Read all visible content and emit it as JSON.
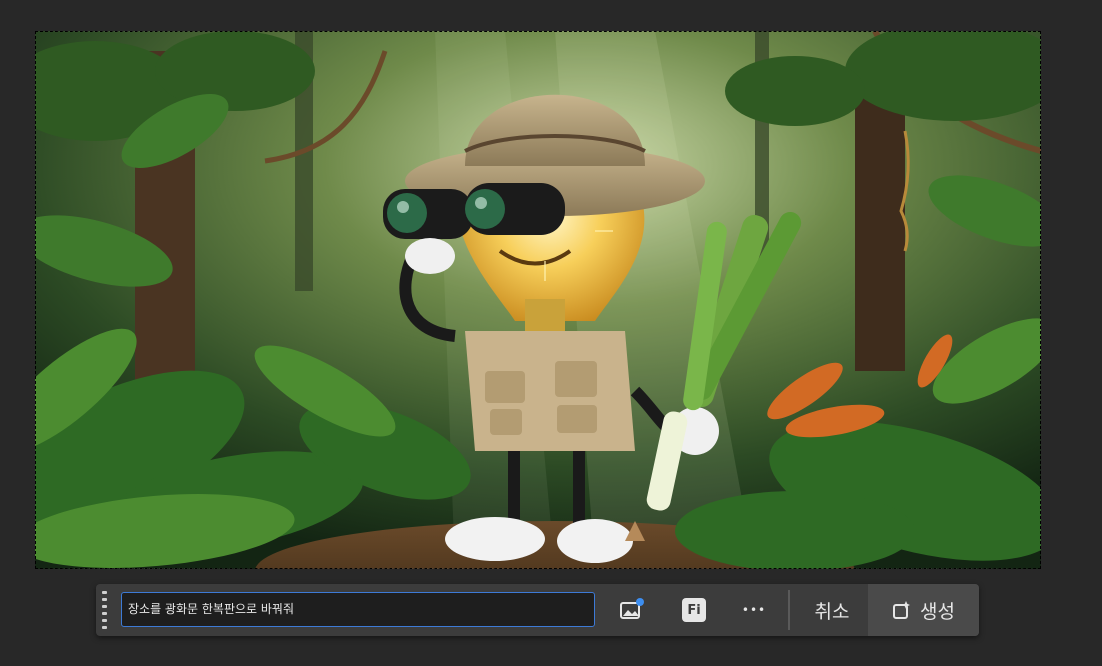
{
  "image": {
    "description_icon": "document-image"
  },
  "taskbar": {
    "prompt_value": "장소를 광화문 한복판으로 바꿔줘",
    "buttons": {
      "variations_icon": "image-sparkle-icon",
      "font_label": "Fi",
      "more_label": "•••",
      "cancel_label": "취소",
      "generate_label": "생성"
    }
  },
  "colors": {
    "accent": "#3d7ad6",
    "taskbar_bg": "#3c3c3c",
    "canvas_bg": "#282828"
  }
}
